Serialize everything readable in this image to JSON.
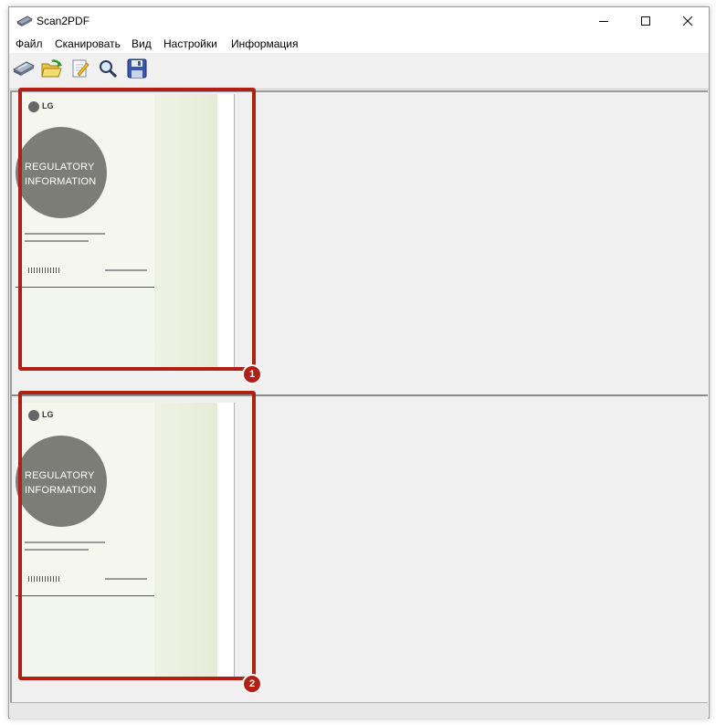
{
  "window": {
    "title": "Scan2PDF",
    "icon": "scanner-icon",
    "controls": [
      "minimize-icon",
      "maximize-icon",
      "close-icon"
    ]
  },
  "menu": {
    "file": "Файл",
    "scan": "Сканировать",
    "view": "Вид",
    "settings": "Настройки",
    "info": "Информация"
  },
  "toolbar": {
    "buttons": [
      "scan-icon",
      "open-folder-icon",
      "edit-icon",
      "zoom-icon",
      "save-icon"
    ]
  },
  "pages": [
    {
      "badge": "1",
      "brand": "LG",
      "cover_line1": "REGULATORY",
      "cover_line2": "INFORMATION"
    },
    {
      "badge": "2",
      "brand": "LG",
      "cover_line1": "REGULATORY",
      "cover_line2": "INFORMATION"
    }
  ],
  "colors": {
    "callout": "#b22015",
    "window_bg": "#f0f0f0"
  }
}
